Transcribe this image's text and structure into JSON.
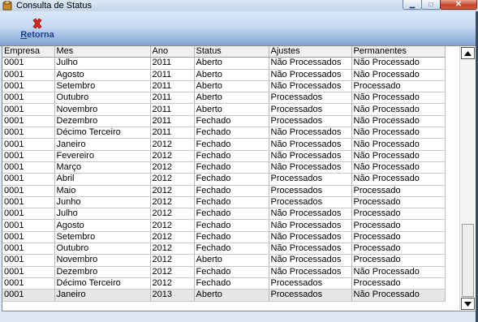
{
  "window": {
    "title": "Consulta de Status",
    "min_symbol": "▁",
    "max_symbol": "□",
    "close_symbol": "✕"
  },
  "toolbar": {
    "return_label_first": "R",
    "return_label_rest": "etorna",
    "return_icon_color": "#d92c1f"
  },
  "grid": {
    "columns": [
      "Empresa",
      "Mes",
      "Ano",
      "Status",
      "Ajustes",
      "Permanentes"
    ],
    "rows": [
      [
        "0001",
        "Julho",
        "2011",
        "Aberto",
        "Não Processados",
        "Não Processado"
      ],
      [
        "0001",
        "Agosto",
        "2011",
        "Aberto",
        "Não Processados",
        "Não Processado"
      ],
      [
        "0001",
        "Setembro",
        "2011",
        "Aberto",
        "Não Processados",
        "Processado"
      ],
      [
        "0001",
        "Outubro",
        "2011",
        "Aberto",
        "Processados",
        "Não Processado"
      ],
      [
        "0001",
        "Novembro",
        "2011",
        "Aberto",
        "Processados",
        "Não Processado"
      ],
      [
        "0001",
        "Dezembro",
        "2011",
        "Fechado",
        "Processados",
        "Não Processado"
      ],
      [
        "0001",
        "Décimo Terceiro",
        "2011",
        "Fechado",
        "Não Processados",
        "Não Processado"
      ],
      [
        "0001",
        "Janeiro",
        "2012",
        "Fechado",
        "Não Processados",
        "Não Processado"
      ],
      [
        "0001",
        "Fevereiro",
        "2012",
        "Fechado",
        "Não Processados",
        "Não Processado"
      ],
      [
        "0001",
        "Março",
        "2012",
        "Fechado",
        "Não Processados",
        "Não Processado"
      ],
      [
        "0001",
        "Abril",
        "2012",
        "Fechado",
        "Processados",
        "Não Processado"
      ],
      [
        "0001",
        "Maio",
        "2012",
        "Fechado",
        "Processados",
        "Processado"
      ],
      [
        "0001",
        "Junho",
        "2012",
        "Fechado",
        "Processados",
        "Processado"
      ],
      [
        "0001",
        "Julho",
        "2012",
        "Fechado",
        "Não Processados",
        "Processado"
      ],
      [
        "0001",
        "Agosto",
        "2012",
        "Fechado",
        "Não Processados",
        "Processado"
      ],
      [
        "0001",
        "Setembro",
        "2012",
        "Fechado",
        "Não Processados",
        "Processado"
      ],
      [
        "0001",
        "Outubro",
        "2012",
        "Fechado",
        "Não Processados",
        "Processado"
      ],
      [
        "0001",
        "Novembro",
        "2012",
        "Aberto",
        "Não Processados",
        "Processado"
      ],
      [
        "0001",
        "Dezembro",
        "2012",
        "Fechado",
        "Não Processados",
        "Não Processado"
      ],
      [
        "0001",
        "Décimo Terceiro",
        "2012",
        "Fechado",
        "Processados",
        "Processado"
      ],
      [
        "0001",
        "Janeiro",
        "2013",
        "Aberto",
        "Processados",
        "Não Processado"
      ]
    ],
    "selected_row_index": 20
  }
}
